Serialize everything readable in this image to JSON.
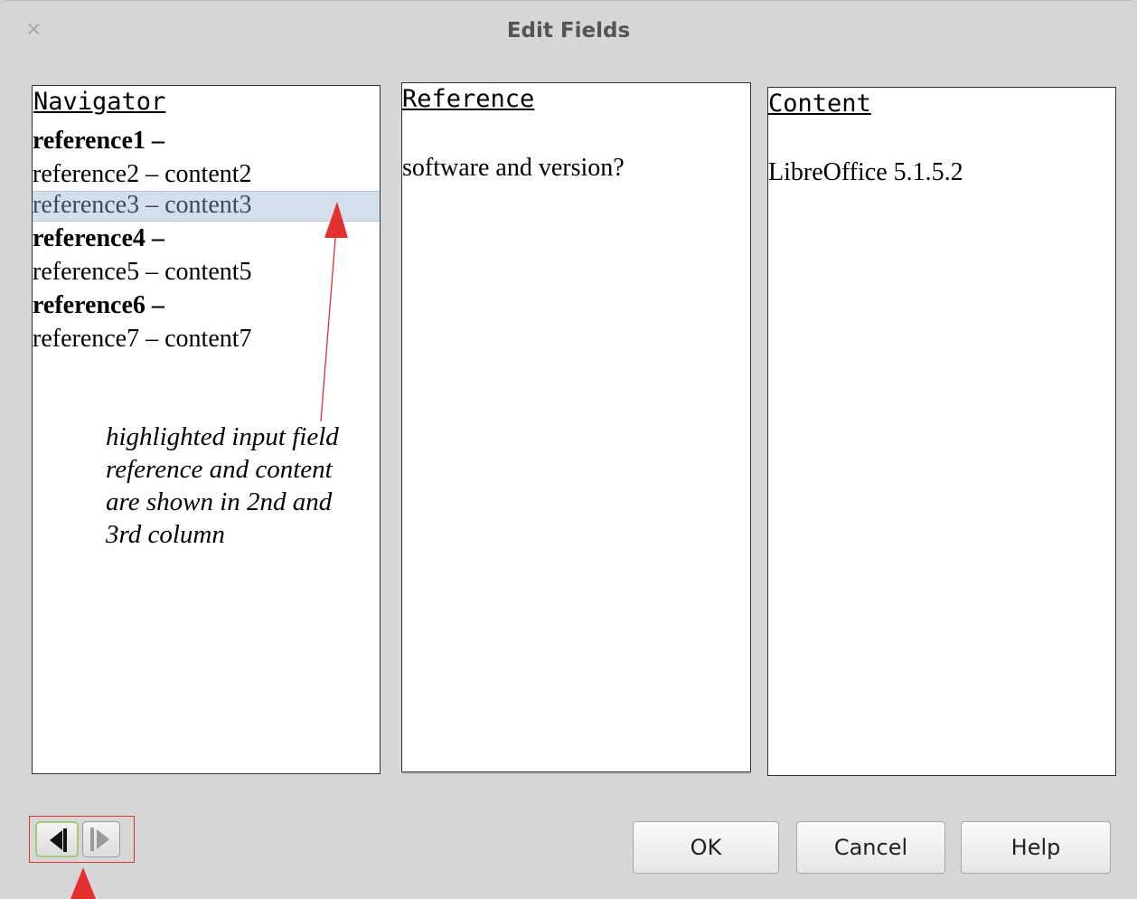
{
  "window": {
    "title": "Edit Fields",
    "close_glyph": "×"
  },
  "navigator": {
    "heading": "Navigator",
    "items": [
      {
        "label": "reference1 –",
        "bold": true,
        "selected": false
      },
      {
        "label": "reference2 – content2",
        "bold": false,
        "selected": false
      },
      {
        "label": "reference3 – content3",
        "bold": false,
        "selected": true
      },
      {
        "label": "reference4 –",
        "bold": true,
        "selected": false
      },
      {
        "label": "reference5 – content5",
        "bold": false,
        "selected": false
      },
      {
        "label": "reference6 –",
        "bold": true,
        "selected": false
      },
      {
        "label": "reference7 – content7",
        "bold": false,
        "selected": false
      }
    ]
  },
  "reference": {
    "heading": "Reference",
    "value": "software and version?"
  },
  "content": {
    "heading": "Content",
    "value": "LibreOffice 5.1.5.2"
  },
  "annotation": {
    "lines": [
      "highlighted input field",
      "reference and content",
      "are shown in 2nd and",
      "3rd column"
    ],
    "color": "#e53030"
  },
  "nav_buttons": {
    "prev_icon": "triangle-left-icon",
    "next_icon": "triangle-right-icon"
  },
  "buttons": {
    "ok": "OK",
    "cancel": "Cancel",
    "help": "Help"
  },
  "colors": {
    "selection": "#d3e0ec",
    "dialog_bg": "#d6d6d6",
    "annotation_red": "#e53030"
  }
}
